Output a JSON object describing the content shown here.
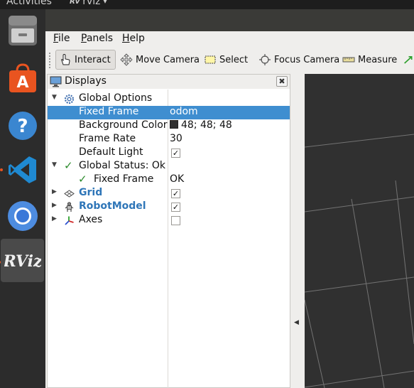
{
  "topbar": {
    "activities": "Activities",
    "app_name": "rviz",
    "app_icon": "rviz-mini-icon"
  },
  "dock": {
    "items": [
      {
        "name": "Files",
        "icon": "file-cabinet-icon"
      },
      {
        "name": "Ubuntu Software",
        "icon": "shopping-bag-icon"
      },
      {
        "name": "Help",
        "icon": "help-icon"
      },
      {
        "name": "Visual Studio Code",
        "icon": "vscode-icon"
      },
      {
        "name": "Chromium",
        "icon": "chromium-icon"
      },
      {
        "name": "RViz",
        "icon": "rviz-icon",
        "label": "RViz"
      }
    ],
    "accent": "#e95420"
  },
  "menu": {
    "file": "File",
    "panels": "Panels",
    "help": "Help"
  },
  "toolbar": {
    "interact": "Interact",
    "move_camera": "Move Camera",
    "select": "Select",
    "focus_camera": "Focus Camera",
    "measure": "Measure"
  },
  "displays": {
    "title": "Displays",
    "close": "✖",
    "rows": {
      "global_options": "Global Options",
      "fixed_frame": "Fixed Frame",
      "fixed_frame_value": "odom",
      "background_color": "Background Color",
      "background_color_value": "48; 48; 48",
      "frame_rate": "Frame Rate",
      "frame_rate_value": "30",
      "default_light": "Default Light",
      "global_status": "Global Status: Ok",
      "status_fixed_frame": "Fixed Frame",
      "status_fixed_frame_value": "OK",
      "grid": "Grid",
      "robot_model": "RobotModel",
      "axes": "Axes"
    },
    "checks": {
      "default_light": true,
      "grid": true,
      "robot_model": true,
      "axes": false
    },
    "colors": {
      "selection": "#3f8ed0",
      "ok_green": "#2a8a2a",
      "plugin_blue": "#2f76b8",
      "background": "#303030"
    }
  }
}
